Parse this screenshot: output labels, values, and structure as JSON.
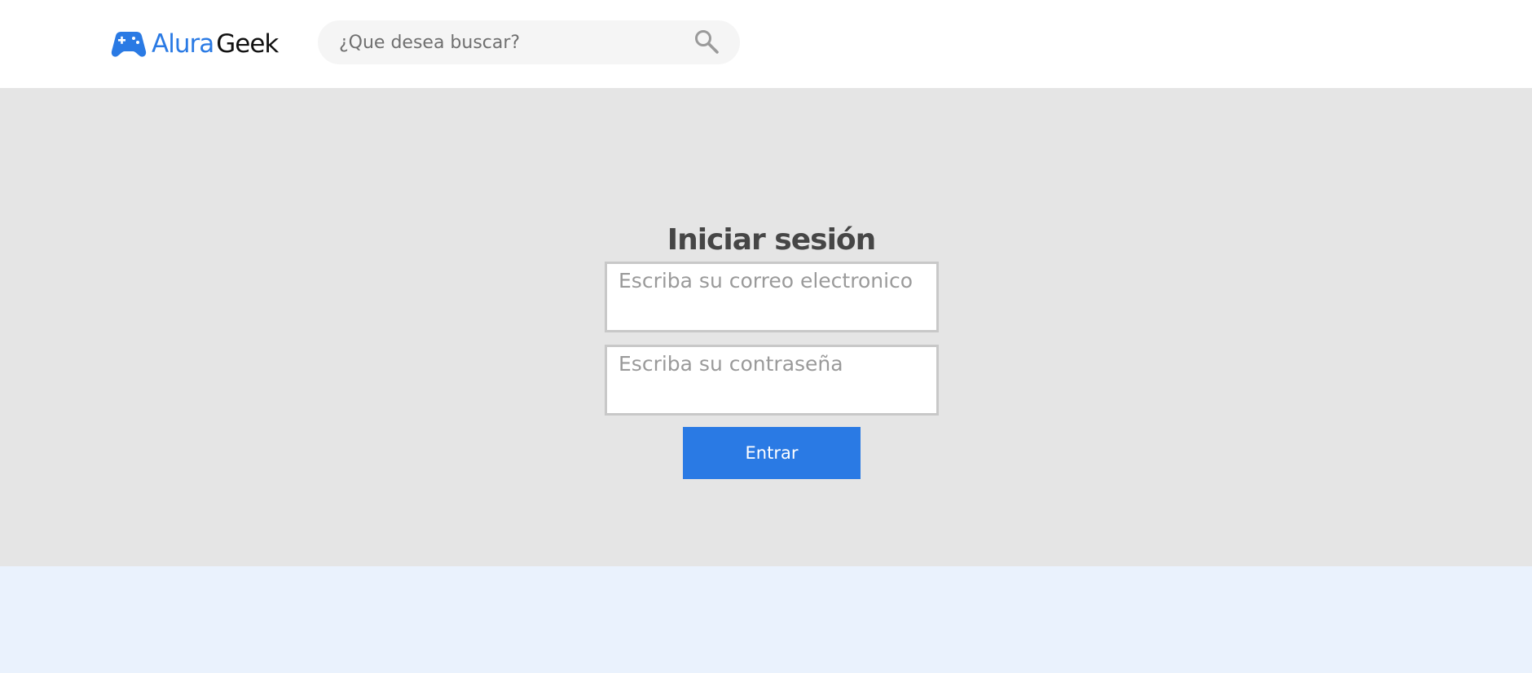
{
  "header": {
    "logo": {
      "alura": "Alura",
      "geek": "Geek"
    },
    "search": {
      "placeholder": "¿Que desea buscar?",
      "icon": "search-icon"
    }
  },
  "login": {
    "title": "Iniciar sesión",
    "email_placeholder": "Escriba su correo electronico",
    "password_placeholder": "Escriba su contraseña",
    "submit_label": "Entrar"
  },
  "colors": {
    "brand": "#2a7ae4",
    "header_bg": "#ffffff",
    "main_bg": "#e5e5e5",
    "footer_bg": "#eaf2fd",
    "text": "#464646"
  }
}
